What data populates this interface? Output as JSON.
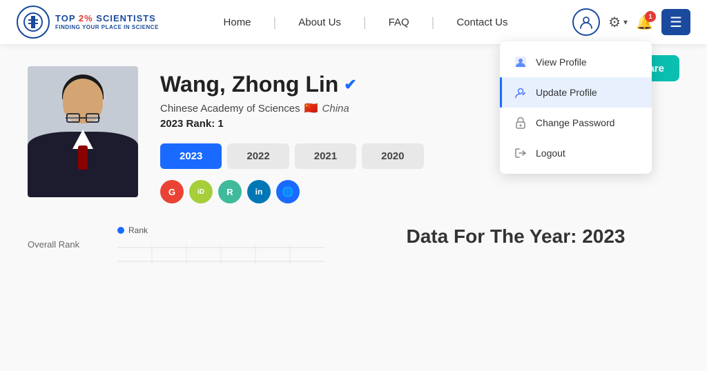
{
  "header": {
    "logo": {
      "title_part1": "TOP ",
      "title_part2": "2%",
      "title_part3": " SCIENTISTS",
      "subtitle": "FINDING YOUR PLACE IN SCIENCE"
    },
    "nav": [
      {
        "label": "Home",
        "id": "home"
      },
      {
        "label": "About Us",
        "id": "about"
      },
      {
        "label": "FAQ",
        "id": "faq"
      },
      {
        "label": "Contact Us",
        "id": "contact"
      }
    ],
    "notification_count": "1"
  },
  "dropdown": {
    "items": [
      {
        "id": "view-profile",
        "label": "View Profile",
        "icon": "person-icon"
      },
      {
        "id": "update-profile",
        "label": "Update Profile",
        "icon": "edit-person-icon"
      },
      {
        "id": "change-password",
        "label": "Change Password",
        "icon": "lock-icon"
      },
      {
        "id": "logout",
        "label": "Logout",
        "icon": "logout-icon"
      }
    ]
  },
  "share_button": {
    "label": "Share"
  },
  "profile": {
    "name": "Wang, Zhong Lin",
    "institution": "Chinese Academy of Sciences",
    "country": "China",
    "year_rank_label": "2023 Rank:",
    "rank_value": "1",
    "year_tabs": [
      {
        "label": "2023",
        "active": true
      },
      {
        "label": "2022",
        "active": false
      },
      {
        "label": "2021",
        "active": false
      },
      {
        "label": "2020",
        "active": false
      }
    ],
    "social_links": [
      {
        "id": "google-scholar",
        "letter": "G",
        "color": "#ea4335"
      },
      {
        "id": "orcid",
        "letter": "iD",
        "color": "#a6ce39"
      },
      {
        "id": "researchgate",
        "letter": "R",
        "color": "#40ba9b"
      },
      {
        "id": "linkedin",
        "letter": "in",
        "color": "#0077b5"
      },
      {
        "id": "website",
        "letter": "🌐",
        "color": "#1a6aff"
      }
    ]
  },
  "bottom": {
    "overall_rank_label": "Overall Rank",
    "chart_legend_label": "Rank",
    "data_title": "Data For The Year: 2023"
  }
}
